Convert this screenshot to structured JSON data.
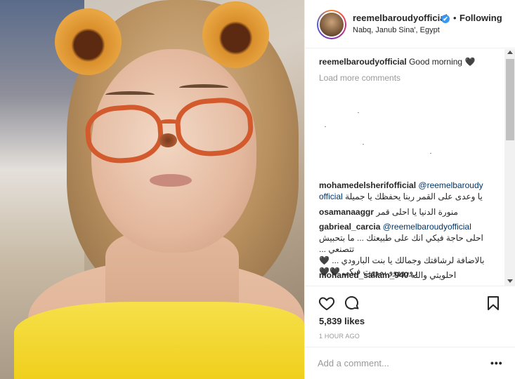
{
  "post": {
    "username": "reemelbaroudyofficial",
    "verified_badge": "✔",
    "separator": "•",
    "follow_status": "Following",
    "location": "Nabq, Janub Sina', Egypt",
    "caption_user": "reemelbaroudyofficial",
    "caption_text": "Good morning 🖤",
    "load_more": "Load more comments"
  },
  "comments": [
    {
      "user": "mohamedelsherifofficial",
      "mention": "@reemelbaroudy",
      "mention_tail": "official",
      "text": "يا وعدى على القمر ربنا يحفظك يا جميلة"
    },
    {
      "user": "osamanaaggr",
      "text": "منورة الدنيا يا احلى قمر"
    },
    {
      "user": "gabrieal_carcia",
      "mention": "@reemelbaroudyofficial",
      "lines": [
        "احلى حاجة فيكي انك على طبيعتك ... ما بتحبيش تتصنعي ...",
        "بالاضافة لرشاقتك وجمالك يا بنت البارودي ... 🖤",
        "روروووو بمووت فيكي 🖤🖤"
      ]
    },
    {
      "user": "mohamed_sallam_940",
      "text": "احلويتي والله"
    }
  ],
  "stats": {
    "likes": "5,839 likes",
    "time": "1 HOUR AGO"
  },
  "composer": {
    "placeholder": "Add a comment...",
    "more_label": "•••"
  },
  "icons": {
    "like": "heart-icon",
    "comment": "comment-bubble-icon",
    "save": "bookmark-icon"
  }
}
